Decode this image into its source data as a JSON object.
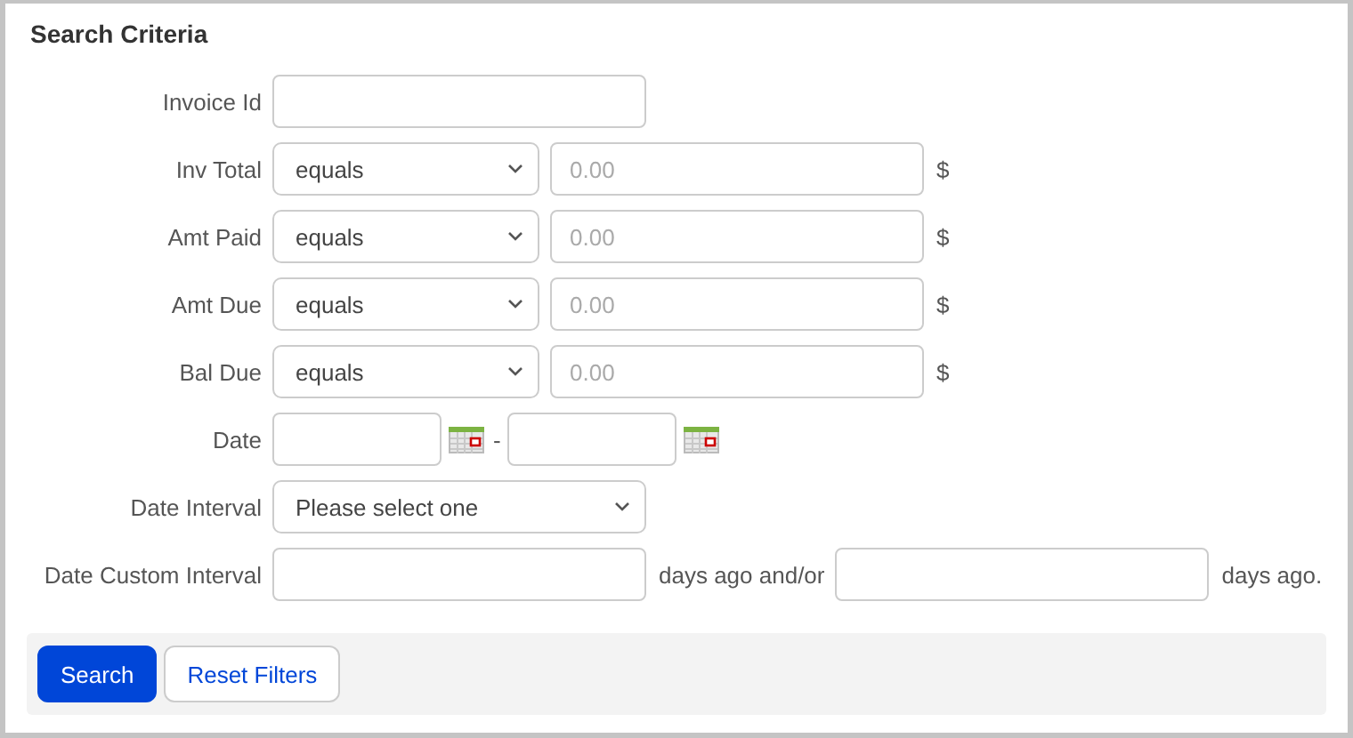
{
  "title": "Search Criteria",
  "rows": [
    {
      "kind": "text",
      "label": "Invoice Id"
    },
    {
      "kind": "compare",
      "label": "Inv Total",
      "operator": "equals",
      "placeholder": "0.00",
      "unit": "$"
    },
    {
      "kind": "compare",
      "label": "Amt Paid",
      "operator": "equals",
      "placeholder": "0.00",
      "unit": "$"
    },
    {
      "kind": "compare",
      "label": "Amt Due",
      "operator": "equals",
      "placeholder": "0.00",
      "unit": "$"
    },
    {
      "kind": "compare",
      "label": "Bal Due",
      "operator": "equals",
      "placeholder": "0.00",
      "unit": "$"
    },
    {
      "kind": "date_range",
      "label": "Date",
      "separator": "-"
    },
    {
      "kind": "select",
      "label": "Date Interval",
      "value": "Please select one"
    },
    {
      "kind": "custom_interval",
      "label": "Date Custom Interval",
      "middle": "days ago and/or",
      "suffix": "days ago."
    }
  ],
  "buttons": [
    {
      "label": "Search",
      "kind": "primary"
    },
    {
      "label": "Reset Filters",
      "kind": "secondary"
    }
  ]
}
